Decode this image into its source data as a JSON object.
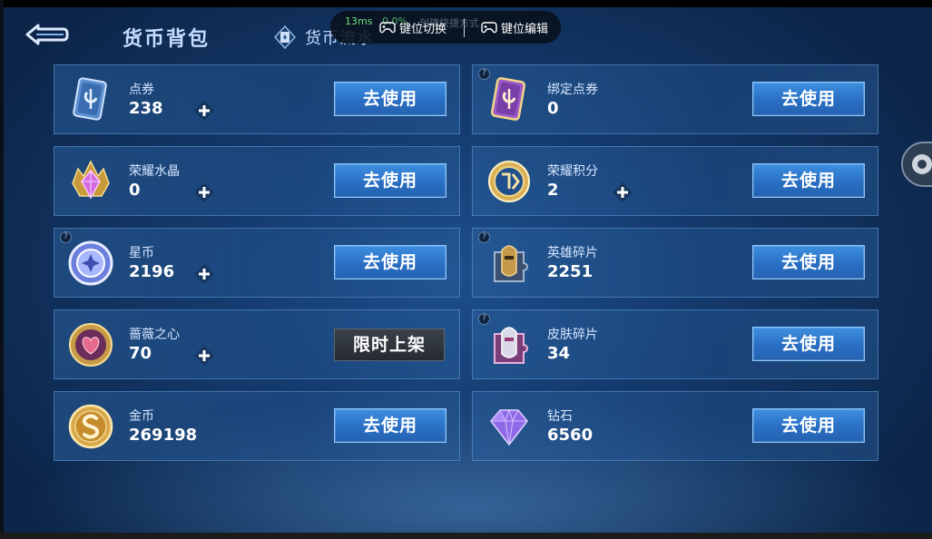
{
  "header": {
    "tab_title": "货币背包",
    "tab_flow_label": "货币流水"
  },
  "overlay": {
    "ping": "13ms",
    "loss": "0.0%",
    "create_shortcut": "创建快捷方式",
    "key_switch": "键位切换",
    "key_edit": "键位编辑"
  },
  "cards": {
    "dianquan": {
      "name": "点券",
      "amount": "238",
      "action": "去使用"
    },
    "bangding": {
      "name": "绑定点券",
      "amount": "0",
      "action": "去使用"
    },
    "shuijing": {
      "name": "荣耀水晶",
      "amount": "0",
      "action": "去使用"
    },
    "jifen": {
      "name": "荣耀积分",
      "amount": "2",
      "action": "去使用"
    },
    "xingbi": {
      "name": "星币",
      "amount": "2196",
      "action": "去使用"
    },
    "yingxiong": {
      "name": "英雄碎片",
      "amount": "2251",
      "action": "去使用"
    },
    "qiangwei": {
      "name": "蔷薇之心",
      "amount": "70",
      "action": "限时上架"
    },
    "pifu": {
      "name": "皮肤碎片",
      "amount": "34",
      "action": "去使用"
    },
    "jinbi": {
      "name": "金币",
      "amount": "269198",
      "action": "去使用"
    },
    "zuanshi": {
      "name": "钻石",
      "amount": "6560",
      "action": "去使用"
    }
  },
  "icon_names": [
    "back-arrow-icon",
    "flow-icon",
    "plus-icon",
    "question-icon",
    "coupon-card-icon",
    "bound-coupon-icon",
    "crystal-icon",
    "points-medal-icon",
    "star-coin-icon",
    "hero-fragment-icon",
    "rose-heart-icon",
    "skin-fragment-icon",
    "gold-coin-icon",
    "diamond-icon",
    "gear-icon"
  ],
  "colors": {
    "accent": "#2a6fc4",
    "panel": "#1d4f8c",
    "ping": "#6ee07a"
  }
}
